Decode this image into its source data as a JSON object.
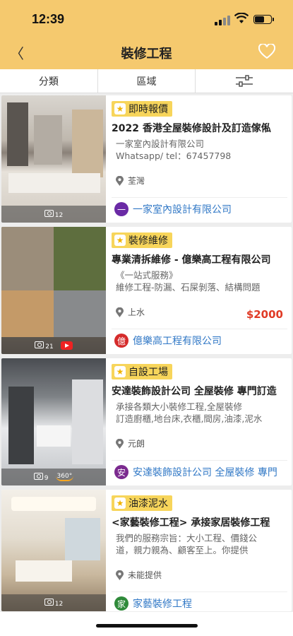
{
  "status": {
    "time": "12:39"
  },
  "nav": {
    "back": "〈",
    "title": "裝修工程"
  },
  "filters": [
    "分類",
    "區域"
  ],
  "listings": [
    {
      "tag": "即時報價",
      "title": "2022 香港全屋裝修設計及訂造傢俬",
      "desc": [
        "一家室內設計有限公司",
        "Whatsapp/ tel：67457798"
      ],
      "location": "荃灣",
      "price": "",
      "company": "一家室內設計有限公司",
      "logo_char": "一",
      "logo_color": "#6a2aa5",
      "photos": "12",
      "video": false,
      "pano": false
    },
    {
      "tag": "裝修維修",
      "title": "專業清拆維修 - 億樂高工程有限公司",
      "desc": [
        "《一站式服務》",
        "維修工程-防漏、石屎剝落、結構問題"
      ],
      "location": "上水",
      "price": "$2000",
      "company": "億樂高工程有限公司",
      "logo_char": "億",
      "logo_color": "#d52b2b",
      "photos": "21",
      "video": true,
      "pano": false
    },
    {
      "tag": "自設工場",
      "title": "安達裝飾設計公司 全屋裝修 專門訂造",
      "desc": [
        "承接各類大小裝修工程,全屋裝修",
        "訂造廚櫃,地台床,衣櫃,間房,油漆,泥水"
      ],
      "location": "元朗",
      "price": "",
      "company": "安達裝飾設計公司 全屋裝修 專門",
      "logo_char": "安",
      "logo_color": "#7b2a8f",
      "photos": "9",
      "video": false,
      "pano": true,
      "pano_label": "360°"
    },
    {
      "tag": "油漆泥水",
      "title": "<家藝裝修工程> 承接家居裝修工程",
      "desc": [
        "我們的服務宗旨：大小工程、價錢公",
        "道，親力親為、顧客至上。你提供"
      ],
      "location": "未能提供",
      "price": "",
      "company": "家藝裝修工程",
      "logo_char": "家",
      "logo_color": "#2f8a3a",
      "photos": "12",
      "video": false,
      "pano": false
    }
  ]
}
